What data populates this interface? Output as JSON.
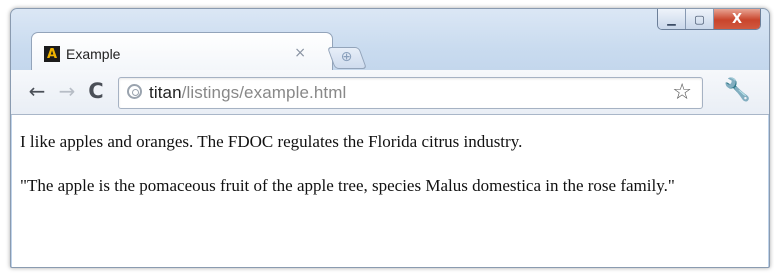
{
  "window": {
    "controls": {
      "minimize": "▁",
      "maximize": "▢",
      "close": "X"
    }
  },
  "tab": {
    "favicon": "A",
    "title": "Example",
    "close": "×",
    "new_tab_icon": "⊕"
  },
  "toolbar": {
    "back": "←",
    "forward": "→",
    "reload": "C",
    "url_host": "titan",
    "url_path": "/listings/example.html",
    "star": "☆",
    "wrench": "🔧"
  },
  "page": {
    "paragraphs": [
      "I like apples and oranges. The FDOC regulates the Florida citrus industry.",
      "\"The apple is the pomaceous fruit of the apple tree, species Malus domestica in the rose family.\""
    ]
  }
}
